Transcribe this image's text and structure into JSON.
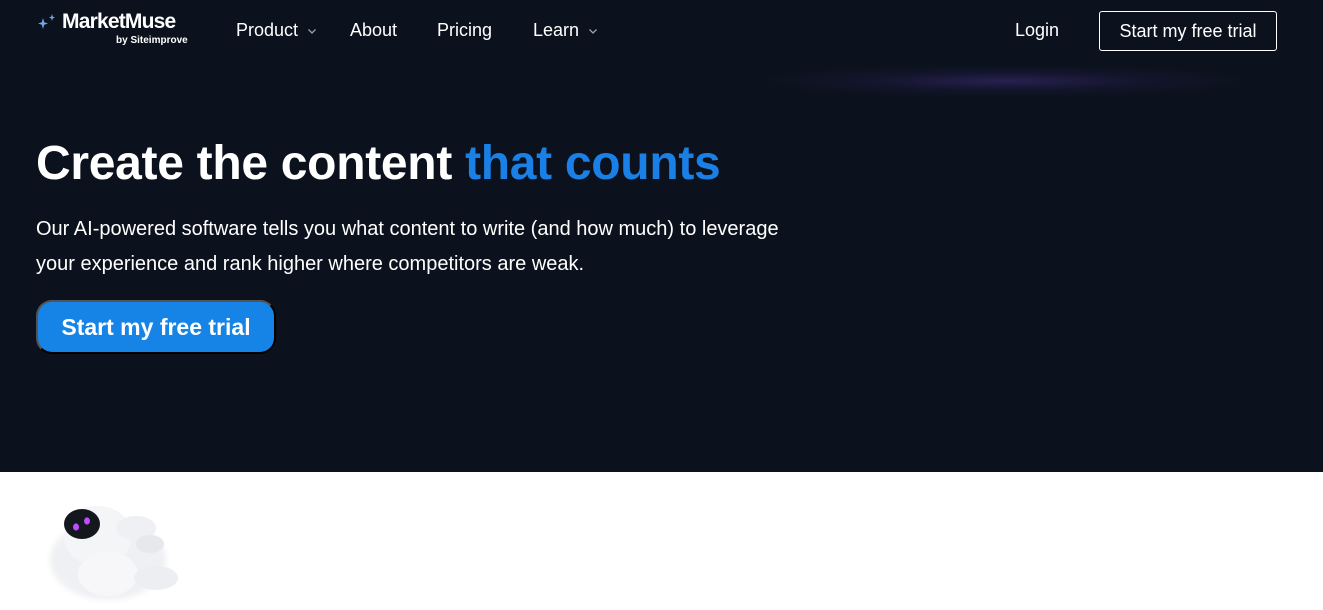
{
  "header": {
    "logo": {
      "name": "MarketMuse",
      "sub": "by Siteimprove",
      "icon": "sparkle-icon",
      "icon_color": "#6ea8e8"
    },
    "nav": [
      {
        "label": "Product",
        "has_dropdown": true
      },
      {
        "label": "About",
        "has_dropdown": false
      },
      {
        "label": "Pricing",
        "has_dropdown": false
      },
      {
        "label": "Learn",
        "has_dropdown": true
      }
    ],
    "login_label": "Login",
    "cta_label": "Start my free trial"
  },
  "hero": {
    "headline_part1": "Create the content",
    "headline_accent": "that counts",
    "subtext": "Our AI-powered software tells you what content to write (and how much) to leverage your experience and rank higher where competitors are weak.",
    "cta_label": "Start my free trial"
  },
  "colors": {
    "background": "#0c121d",
    "accent": "#1a80e5",
    "button": "#1584e6",
    "mascot_eyes": "#c04cff"
  }
}
